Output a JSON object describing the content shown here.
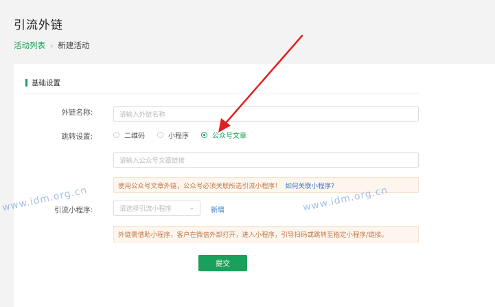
{
  "header": {
    "title": "引流外链",
    "breadcrumb": {
      "parent": "活动列表",
      "separator": "›",
      "current": "新建活动"
    }
  },
  "section": {
    "title": "基础设置"
  },
  "form": {
    "link_name_label": "外链名称:",
    "link_name_placeholder": "请输入外链名称",
    "redirect_label": "跳转设置:",
    "redirect_options": [
      {
        "label": "二维码",
        "selected": false
      },
      {
        "label": "小程序",
        "selected": false
      },
      {
        "label": "公众号文章",
        "selected": true
      }
    ],
    "article_link_placeholder": "请输入公众号文章链接",
    "notice_text": "使用公众号文章外链，公众号必须关联所选引流小程序！",
    "notice_link": "如何关联小程序?",
    "mini_program_label": "引流小程序:",
    "mini_program_placeholder": "请选择引流小程序",
    "add_label": "新增",
    "info_text": "外链需借助小程序，客户在微信外部打开，进入小程序，引导扫码或跳转至指定小程序/链接。",
    "submit_label": "提交"
  },
  "watermark": {
    "text": "www.idm.org.cn"
  },
  "colors": {
    "accent": "#19a05a",
    "link": "#3a78c9",
    "warning_text": "#c0794a",
    "arrow": "#e02020"
  }
}
